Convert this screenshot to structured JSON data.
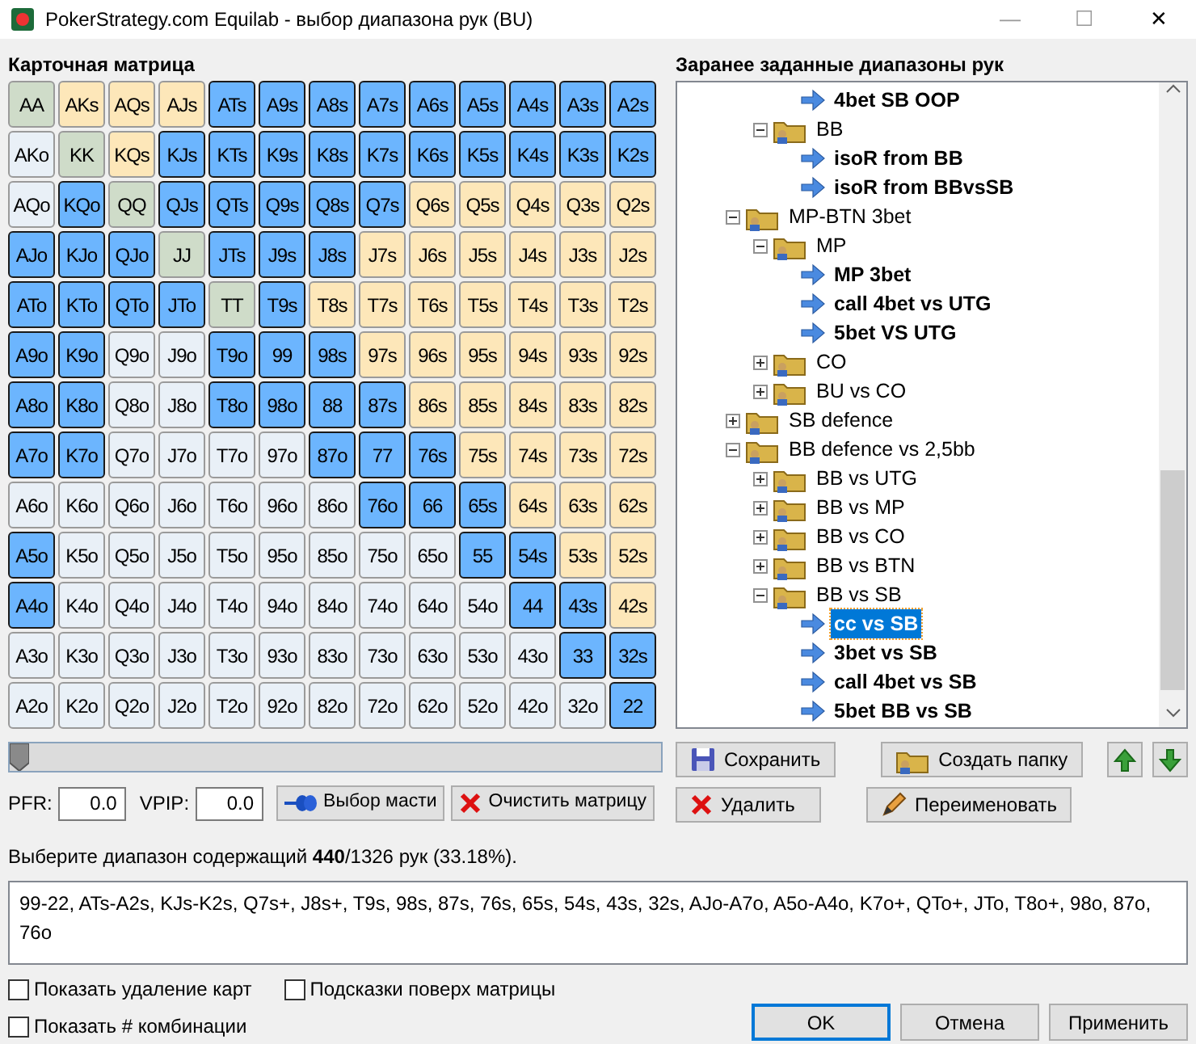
{
  "window": {
    "title": "PokerStrategy.com Equilab - выбор диапазона рук (BU)",
    "controls": [
      "—",
      "☐",
      "✕"
    ]
  },
  "matrix": {
    "title": "Карточная матрица",
    "rows": [
      [
        {
          "label": "AA",
          "selected": false
        },
        {
          "label": "AKs",
          "selected": false
        },
        {
          "label": "AQs",
          "selected": false
        },
        {
          "label": "AJs",
          "selected": false
        },
        {
          "label": "ATs",
          "selected": true
        },
        {
          "label": "A9s",
          "selected": true
        },
        {
          "label": "A8s",
          "selected": true
        },
        {
          "label": "A7s",
          "selected": true
        },
        {
          "label": "A6s",
          "selected": true
        },
        {
          "label": "A5s",
          "selected": true
        },
        {
          "label": "A4s",
          "selected": true
        },
        {
          "label": "A3s",
          "selected": true
        },
        {
          "label": "A2s",
          "selected": true
        }
      ],
      [
        {
          "label": "AKo",
          "selected": false
        },
        {
          "label": "KK",
          "selected": false
        },
        {
          "label": "KQs",
          "selected": false
        },
        {
          "label": "KJs",
          "selected": true
        },
        {
          "label": "KTs",
          "selected": true
        },
        {
          "label": "K9s",
          "selected": true
        },
        {
          "label": "K8s",
          "selected": true
        },
        {
          "label": "K7s",
          "selected": true
        },
        {
          "label": "K6s",
          "selected": true
        },
        {
          "label": "K5s",
          "selected": true
        },
        {
          "label": "K4s",
          "selected": true
        },
        {
          "label": "K3s",
          "selected": true
        },
        {
          "label": "K2s",
          "selected": true
        }
      ],
      [
        {
          "label": "AQo",
          "selected": false
        },
        {
          "label": "KQo",
          "selected": true
        },
        {
          "label": "QQ",
          "selected": false
        },
        {
          "label": "QJs",
          "selected": true
        },
        {
          "label": "QTs",
          "selected": true
        },
        {
          "label": "Q9s",
          "selected": true
        },
        {
          "label": "Q8s",
          "selected": true
        },
        {
          "label": "Q7s",
          "selected": true
        },
        {
          "label": "Q6s",
          "selected": false
        },
        {
          "label": "Q5s",
          "selected": false
        },
        {
          "label": "Q4s",
          "selected": false
        },
        {
          "label": "Q3s",
          "selected": false
        },
        {
          "label": "Q2s",
          "selected": false
        }
      ],
      [
        {
          "label": "AJo",
          "selected": true
        },
        {
          "label": "KJo",
          "selected": true
        },
        {
          "label": "QJo",
          "selected": true
        },
        {
          "label": "JJ",
          "selected": false
        },
        {
          "label": "JTs",
          "selected": true
        },
        {
          "label": "J9s",
          "selected": true
        },
        {
          "label": "J8s",
          "selected": true
        },
        {
          "label": "J7s",
          "selected": false
        },
        {
          "label": "J6s",
          "selected": false
        },
        {
          "label": "J5s",
          "selected": false
        },
        {
          "label": "J4s",
          "selected": false
        },
        {
          "label": "J3s",
          "selected": false
        },
        {
          "label": "J2s",
          "selected": false
        }
      ],
      [
        {
          "label": "ATo",
          "selected": true
        },
        {
          "label": "KTo",
          "selected": true
        },
        {
          "label": "QTo",
          "selected": true
        },
        {
          "label": "JTo",
          "selected": true
        },
        {
          "label": "TT",
          "selected": false
        },
        {
          "label": "T9s",
          "selected": true
        },
        {
          "label": "T8s",
          "selected": false
        },
        {
          "label": "T7s",
          "selected": false
        },
        {
          "label": "T6s",
          "selected": false
        },
        {
          "label": "T5s",
          "selected": false
        },
        {
          "label": "T4s",
          "selected": false
        },
        {
          "label": "T3s",
          "selected": false
        },
        {
          "label": "T2s",
          "selected": false
        }
      ],
      [
        {
          "label": "A9o",
          "selected": true
        },
        {
          "label": "K9o",
          "selected": true
        },
        {
          "label": "Q9o",
          "selected": false
        },
        {
          "label": "J9o",
          "selected": false
        },
        {
          "label": "T9o",
          "selected": true
        },
        {
          "label": "99",
          "selected": true
        },
        {
          "label": "98s",
          "selected": true
        },
        {
          "label": "97s",
          "selected": false
        },
        {
          "label": "96s",
          "selected": false
        },
        {
          "label": "95s",
          "selected": false
        },
        {
          "label": "94s",
          "selected": false
        },
        {
          "label": "93s",
          "selected": false
        },
        {
          "label": "92s",
          "selected": false
        }
      ],
      [
        {
          "label": "A8o",
          "selected": true
        },
        {
          "label": "K8o",
          "selected": true
        },
        {
          "label": "Q8o",
          "selected": false
        },
        {
          "label": "J8o",
          "selected": false
        },
        {
          "label": "T8o",
          "selected": true
        },
        {
          "label": "98o",
          "selected": true
        },
        {
          "label": "88",
          "selected": true
        },
        {
          "label": "87s",
          "selected": true
        },
        {
          "label": "86s",
          "selected": false
        },
        {
          "label": "85s",
          "selected": false
        },
        {
          "label": "84s",
          "selected": false
        },
        {
          "label": "83s",
          "selected": false
        },
        {
          "label": "82s",
          "selected": false
        }
      ],
      [
        {
          "label": "A7o",
          "selected": true
        },
        {
          "label": "K7o",
          "selected": true
        },
        {
          "label": "Q7o",
          "selected": false
        },
        {
          "label": "J7o",
          "selected": false
        },
        {
          "label": "T7o",
          "selected": false
        },
        {
          "label": "97o",
          "selected": false
        },
        {
          "label": "87o",
          "selected": true
        },
        {
          "label": "77",
          "selected": true
        },
        {
          "label": "76s",
          "selected": true
        },
        {
          "label": "75s",
          "selected": false
        },
        {
          "label": "74s",
          "selected": false
        },
        {
          "label": "73s",
          "selected": false
        },
        {
          "label": "72s",
          "selected": false
        }
      ],
      [
        {
          "label": "A6o",
          "selected": false
        },
        {
          "label": "K6o",
          "selected": false
        },
        {
          "label": "Q6o",
          "selected": false
        },
        {
          "label": "J6o",
          "selected": false
        },
        {
          "label": "T6o",
          "selected": false
        },
        {
          "label": "96o",
          "selected": false
        },
        {
          "label": "86o",
          "selected": false
        },
        {
          "label": "76o",
          "selected": true
        },
        {
          "label": "66",
          "selected": true
        },
        {
          "label": "65s",
          "selected": true
        },
        {
          "label": "64s",
          "selected": false
        },
        {
          "label": "63s",
          "selected": false
        },
        {
          "label": "62s",
          "selected": false
        }
      ],
      [
        {
          "label": "A5o",
          "selected": true
        },
        {
          "label": "K5o",
          "selected": false
        },
        {
          "label": "Q5o",
          "selected": false
        },
        {
          "label": "J5o",
          "selected": false
        },
        {
          "label": "T5o",
          "selected": false
        },
        {
          "label": "95o",
          "selected": false
        },
        {
          "label": "85o",
          "selected": false
        },
        {
          "label": "75o",
          "selected": false
        },
        {
          "label": "65o",
          "selected": false
        },
        {
          "label": "55",
          "selected": true
        },
        {
          "label": "54s",
          "selected": true
        },
        {
          "label": "53s",
          "selected": false
        },
        {
          "label": "52s",
          "selected": false
        }
      ],
      [
        {
          "label": "A4o",
          "selected": true
        },
        {
          "label": "K4o",
          "selected": false
        },
        {
          "label": "Q4o",
          "selected": false
        },
        {
          "label": "J4o",
          "selected": false
        },
        {
          "label": "T4o",
          "selected": false
        },
        {
          "label": "94o",
          "selected": false
        },
        {
          "label": "84o",
          "selected": false
        },
        {
          "label": "74o",
          "selected": false
        },
        {
          "label": "64o",
          "selected": false
        },
        {
          "label": "54o",
          "selected": false
        },
        {
          "label": "44",
          "selected": true
        },
        {
          "label": "43s",
          "selected": true
        },
        {
          "label": "42s",
          "selected": false
        }
      ],
      [
        {
          "label": "A3o",
          "selected": false
        },
        {
          "label": "K3o",
          "selected": false
        },
        {
          "label": "Q3o",
          "selected": false
        },
        {
          "label": "J3o",
          "selected": false
        },
        {
          "label": "T3o",
          "selected": false
        },
        {
          "label": "93o",
          "selected": false
        },
        {
          "label": "83o",
          "selected": false
        },
        {
          "label": "73o",
          "selected": false
        },
        {
          "label": "63o",
          "selected": false
        },
        {
          "label": "53o",
          "selected": false
        },
        {
          "label": "43o",
          "selected": false
        },
        {
          "label": "33",
          "selected": true
        },
        {
          "label": "32s",
          "selected": true
        }
      ],
      [
        {
          "label": "A2o",
          "selected": false
        },
        {
          "label": "K2o",
          "selected": false
        },
        {
          "label": "Q2o",
          "selected": false
        },
        {
          "label": "J2o",
          "selected": false
        },
        {
          "label": "T2o",
          "selected": false
        },
        {
          "label": "92o",
          "selected": false
        },
        {
          "label": "82o",
          "selected": false
        },
        {
          "label": "72o",
          "selected": false
        },
        {
          "label": "62o",
          "selected": false
        },
        {
          "label": "52o",
          "selected": false
        },
        {
          "label": "42o",
          "selected": false
        },
        {
          "label": "32o",
          "selected": false
        },
        {
          "label": "22",
          "selected": true
        }
      ]
    ]
  },
  "slider": {
    "level": 0
  },
  "stats": [
    {
      "label": "PFR:",
      "value": "0.0"
    },
    {
      "label": "VPIP:",
      "value": "0.0"
    }
  ],
  "matrix_buttons": [
    {
      "label": "Выбор масти",
      "kind": "suits"
    },
    {
      "label": "Очистить матрицу",
      "kind": "clear"
    }
  ],
  "presets": {
    "title": "Заранее заданные диапазоны рук",
    "tree": [
      {
        "kind": "offscreen",
        "children": [
          {
            "kind": "offscreen",
            "children": [
              {
                "kind": "leaf",
                "label": "4bet SB OOP",
                "selected": false
              }
            ]
          },
          {
            "kind": "folder",
            "label": "BB",
            "expanded": true,
            "children": [
              {
                "kind": "leaf",
                "label": "isoR from BB",
                "selected": false
              },
              {
                "kind": "leaf",
                "label": "isoR from BBvsSB",
                "selected": false
              }
            ]
          }
        ]
      },
      {
        "kind": "folder",
        "label": "MP-BTN 3bet",
        "expanded": true,
        "children": [
          {
            "kind": "folder",
            "label": "MP",
            "expanded": true,
            "children": [
              {
                "kind": "leaf",
                "label": "MP 3bet",
                "selected": false
              },
              {
                "kind": "leaf",
                "label": "call 4bet vs UTG",
                "selected": false
              },
              {
                "kind": "leaf",
                "label": "5bet VS UTG",
                "selected": false
              }
            ]
          },
          {
            "kind": "folder",
            "label": "CO",
            "expanded": false
          },
          {
            "kind": "folder",
            "label": "BU vs CO",
            "expanded": false
          }
        ]
      },
      {
        "kind": "folder",
        "label": "SB defence",
        "expanded": false
      },
      {
        "kind": "folder",
        "label": "BB defence vs 2,5bb",
        "expanded": true,
        "children": [
          {
            "kind": "folder",
            "label": "BB vs UTG",
            "expanded": false
          },
          {
            "kind": "folder",
            "label": "BB vs MP",
            "expanded": false
          },
          {
            "kind": "folder",
            "label": "BB vs CO",
            "expanded": false
          },
          {
            "kind": "folder",
            "label": "BB vs BTN",
            "expanded": false
          },
          {
            "kind": "folder",
            "label": "BB vs SB",
            "expanded": true,
            "children": [
              {
                "kind": "leaf",
                "label": "cc vs SB",
                "selected": true
              },
              {
                "kind": "leaf",
                "label": "3bet vs SB",
                "selected": false
              },
              {
                "kind": "leaf",
                "label": "call 4bet vs SB",
                "selected": false
              },
              {
                "kind": "leaf",
                "label": "5bet BB vs SB",
                "selected": false
              }
            ]
          }
        ]
      }
    ],
    "button_rows": [
      [
        {
          "label": "Сохранить",
          "kind": "save"
        },
        {
          "label": "Создать папку",
          "kind": "folder"
        },
        {
          "kind": "up"
        },
        {
          "kind": "down"
        }
      ],
      [
        {
          "label": "Удалить",
          "kind": "delete"
        },
        {
          "label": "Переименовать",
          "kind": "rename"
        }
      ]
    ]
  },
  "summary": "Выберите диапазон содержащий **440**/1326 рук (33.18%).",
  "range_text": "99-22, ATs-A2s, KJs-K2s, Q7s+, J8s+, T9s, 98s, 87s, 76s, 65s, 54s, 43s, 32s, AJo-A7o, A5o-A4o, K7o+, QTo+, JTo, T8o+, 98o, 87o, 76o",
  "options": [
    {
      "label": "Показать удаление карт",
      "checked": false
    },
    {
      "label": "Подсказки поверх матрицы",
      "checked": false
    },
    {
      "label": "Показать # комбинации",
      "checked": false
    }
  ],
  "dialog_buttons": [
    {
      "label": "OK",
      "default": true
    },
    {
      "label": "Отмена",
      "default": false
    },
    {
      "label": "Применить",
      "default": false
    }
  ]
}
